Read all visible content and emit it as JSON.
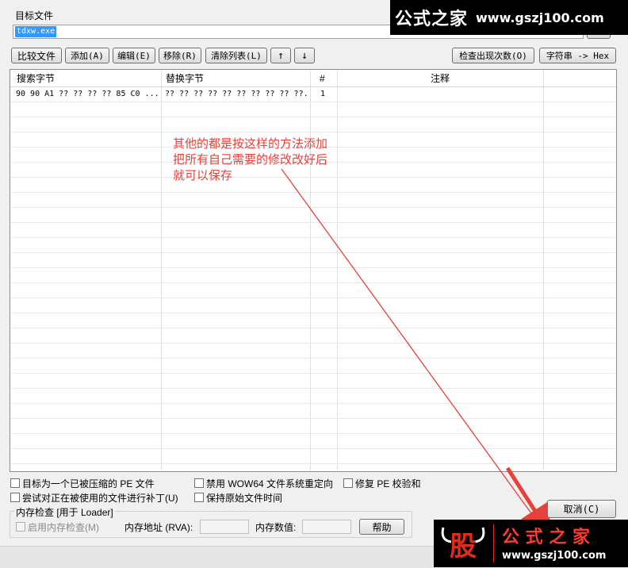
{
  "target": {
    "label": "目标文件",
    "value": "tdxw.exe"
  },
  "toolbar": {
    "compare": "比较文件",
    "add": "添加(A)",
    "edit": "编辑(E)",
    "remove": "移除(R)",
    "clear": "清除列表(L)",
    "up": "↑",
    "down": "↓",
    "check_count": "检查出现次数(O)",
    "string_hex": "字符串 -> Hex"
  },
  "table": {
    "columns": [
      "搜索字节",
      "替换字节",
      "#",
      "注释"
    ],
    "rows": [
      {
        "search": "90 90 A1 ?? ?? ?? ?? 85 C0 ...",
        "replace": "?? ?? ?? ?? ?? ?? ?? ?? ?? ??...",
        "count": "1",
        "comment": ""
      }
    ]
  },
  "annotation": {
    "lines": [
      "其他的都是按这样的方法添加",
      "把所有自己需要的修改改好后",
      "就可以保存"
    ],
    "color": "#e8403a"
  },
  "options": {
    "packed_pe": "目标为一个已被压缩的 PE 文件",
    "patch_in_use": "尝试对正在被使用的文件进行补丁(U)",
    "disable_wow64": "禁用 WOW64 文件系统重定向",
    "keep_time": "保持原始文件时间",
    "fix_checksum": "修复 PE 校验和"
  },
  "memory": {
    "group_label": "内存检查 [用于 Loader]",
    "enable": "启用内存检查(M)",
    "address_label": "内存地址 (RVA):",
    "value_label": "内存数值:",
    "help": "帮助"
  },
  "buttons": {
    "cancel": "取消(C)"
  },
  "watermark_top": {
    "cn": "公式之家",
    "url": "www.gszj100.com"
  },
  "watermark_bottom": {
    "badge": "股",
    "cn": "公 式 之 家",
    "url": "www.gszj100.com"
  }
}
